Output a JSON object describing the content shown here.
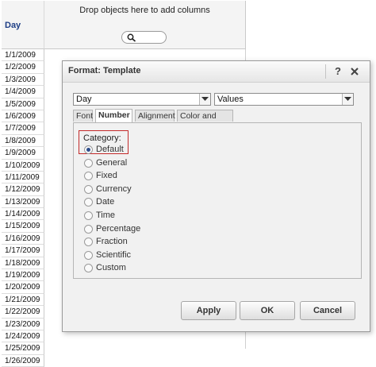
{
  "grid": {
    "column_header": "Day",
    "drop_text": "Drop objects here to add columns",
    "rows": [
      "1/1/2009",
      "1/2/2009",
      "1/3/2009",
      "1/4/2009",
      "1/5/2009",
      "1/6/2009",
      "1/7/2009",
      "1/8/2009",
      "1/9/2009",
      "1/10/2009",
      "1/11/2009",
      "1/12/2009",
      "1/13/2009",
      "1/14/2009",
      "1/15/2009",
      "1/16/2009",
      "1/17/2009",
      "1/18/2009",
      "1/19/2009",
      "1/20/2009",
      "1/21/2009",
      "1/22/2009",
      "1/23/2009",
      "1/24/2009",
      "1/25/2009",
      "1/26/2009"
    ]
  },
  "dialog": {
    "title": "Format: Template",
    "help_label": "?",
    "object_select": "Day",
    "target_select": "Values",
    "tabs": [
      {
        "label": "Font",
        "active": false
      },
      {
        "label": "Number",
        "active": true
      },
      {
        "label": "Alignment",
        "active": false
      },
      {
        "label": "Color and Lines",
        "active": false
      }
    ],
    "category_label": "Category:",
    "categories": [
      {
        "label": "Default",
        "selected": true
      },
      {
        "label": "General",
        "selected": false
      },
      {
        "label": "Fixed",
        "selected": false
      },
      {
        "label": "Currency",
        "selected": false
      },
      {
        "label": "Date",
        "selected": false
      },
      {
        "label": "Time",
        "selected": false
      },
      {
        "label": "Percentage",
        "selected": false
      },
      {
        "label": "Fraction",
        "selected": false
      },
      {
        "label": "Scientific",
        "selected": false
      },
      {
        "label": "Custom",
        "selected": false
      }
    ],
    "buttons": {
      "apply": "Apply",
      "ok": "OK",
      "cancel": "Cancel"
    }
  },
  "colors": {
    "header_text": "#1f3f86",
    "highlight_border": "#c32a2a"
  }
}
